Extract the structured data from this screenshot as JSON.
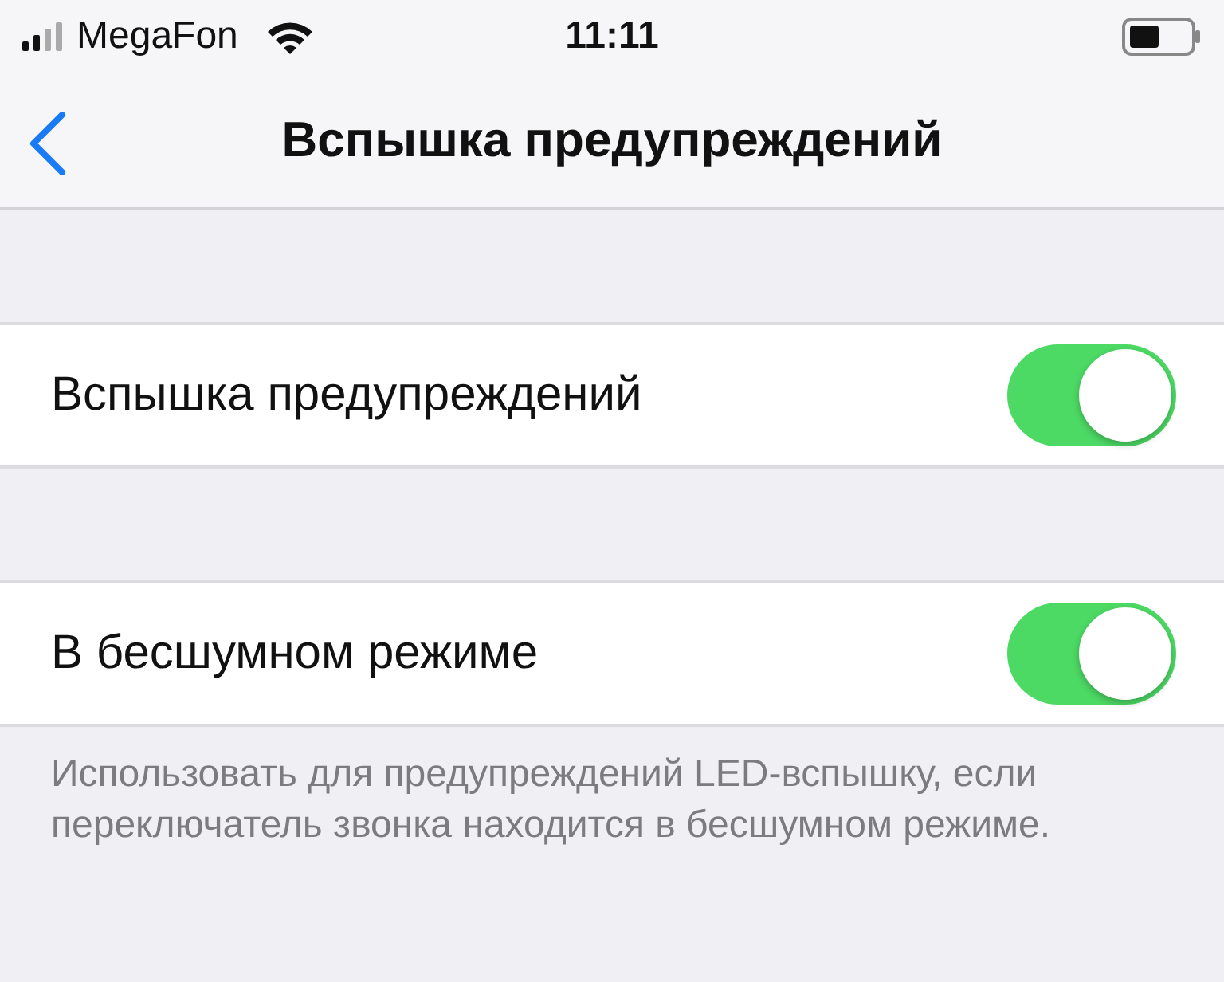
{
  "status_bar": {
    "carrier": "MegaFon",
    "time": "11:11"
  },
  "nav": {
    "title": "Вспышка предупреждений"
  },
  "sections": [
    {
      "rows": [
        {
          "label": "Вспышка предупреждений",
          "on": true
        }
      ]
    },
    {
      "rows": [
        {
          "label": "В бесшумном режиме",
          "on": true
        }
      ],
      "footer": "Использовать для предупреждений LED-вспышку, если переключатель звонка находится в бесшумном режиме."
    }
  ]
}
